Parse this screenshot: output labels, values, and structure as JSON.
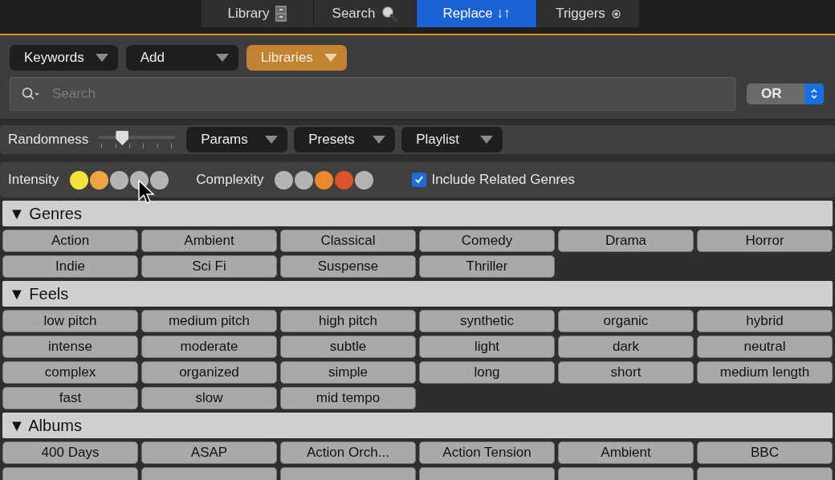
{
  "tabs": [
    {
      "label": "Library",
      "kind": "cabinet",
      "selected": false
    },
    {
      "label": "Search",
      "kind": "magnifier",
      "selected": false
    },
    {
      "label": "Replace ↓↑",
      "kind": "plain",
      "selected": true
    },
    {
      "label": "Triggers",
      "kind": "radio",
      "selected": false
    }
  ],
  "filters": [
    {
      "label": "Keywords",
      "kind": "dark"
    },
    {
      "label": "Add",
      "kind": "dark"
    },
    {
      "label": "Libraries",
      "kind": "accent"
    }
  ],
  "search": {
    "placeholder": "Search"
  },
  "operator": {
    "value": "OR"
  },
  "randomness": {
    "label": "Randomness",
    "level": 0.27
  },
  "menus": [
    "Params",
    "Presets",
    "Playlist"
  ],
  "intensity": {
    "label": "Intensity",
    "dots": [
      {
        "color": "#f4e23c"
      },
      {
        "color": "#eea443"
      },
      {
        "color": "#b4b4b4"
      },
      {
        "color": "#b4b4b4"
      },
      {
        "color": "#b4b4b4"
      }
    ]
  },
  "complexity": {
    "label": "Complexity",
    "dots": [
      {
        "color": "#b4b4b4"
      },
      {
        "color": "#b4b4b4"
      },
      {
        "color": "#e9892b"
      },
      {
        "color": "#de532c"
      },
      {
        "color": "#b4b4b4"
      }
    ]
  },
  "related_genres": {
    "label": "Include Related Genres",
    "checked": true
  },
  "sections": [
    {
      "title": "▼ Genres",
      "items": [
        "Action",
        "Ambient",
        "Classical",
        "Comedy",
        "Drama",
        "Horror",
        "Indie",
        "Sci Fi",
        "Suspense",
        "Thriller"
      ]
    },
    {
      "title": "▼ Feels",
      "items": [
        "low pitch",
        "medium pitch",
        "high pitch",
        "synthetic",
        "organic",
        "hybrid",
        "intense",
        "moderate",
        "subtle",
        "light",
        "dark",
        "neutral",
        "complex",
        "organized",
        "simple",
        "long",
        "short",
        "medium length",
        "fast",
        "slow",
        "mid tempo"
      ]
    },
    {
      "title": "▼ Albums",
      "items": [
        "400 Days",
        "ASAP",
        "Action Orch...",
        "Action Tension",
        "Ambient",
        "BBC"
      ]
    }
  ]
}
